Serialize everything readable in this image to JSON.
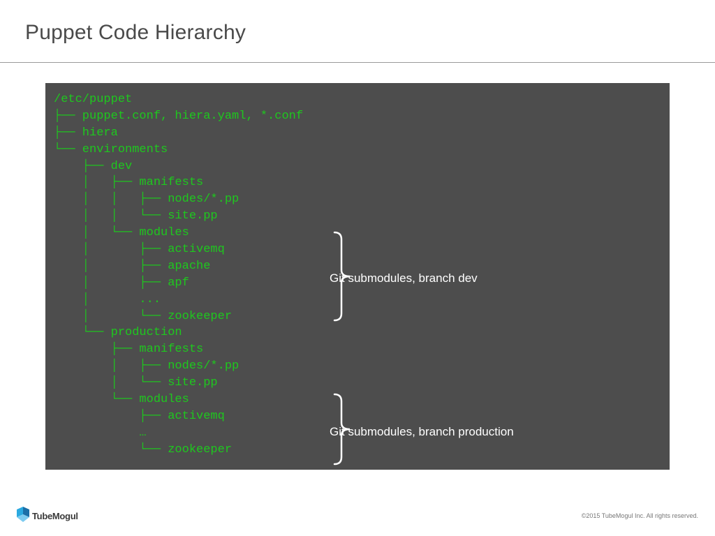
{
  "slide": {
    "title": "Puppet Code Hierarchy"
  },
  "code": {
    "lines": [
      "/etc/puppet",
      "├── puppet.conf, hiera.yaml, *.conf",
      "├── hiera",
      "└── environments",
      "    ├── dev",
      "    │   ├── manifests",
      "    │   │   ├── nodes/*.pp",
      "    │   │   └── site.pp",
      "    │   └── modules",
      "    │       ├── activemq",
      "    │       ├── apache",
      "    │       ├── apf",
      "    │       ...",
      "    │       └── zookeeper",
      "    └── production",
      "        ├── manifests",
      "        │   ├── nodes/*.pp",
      "        │   └── site.pp",
      "        └── modules",
      "            ├── activemq",
      "            …",
      "            └── zookeeper"
    ]
  },
  "annotations": {
    "dev": "Git submodules, branch dev",
    "production": "Git submodules, branch production"
  },
  "footer": {
    "logo_text": "TubeMogul",
    "copyright": "©2015 TubeMogul Inc. All rights reserved."
  },
  "colors": {
    "panel_background": "#4d4d4d",
    "code_text": "#1ec81e",
    "annotation_text": "#ffffff",
    "title_text": "#4a4a4a"
  }
}
